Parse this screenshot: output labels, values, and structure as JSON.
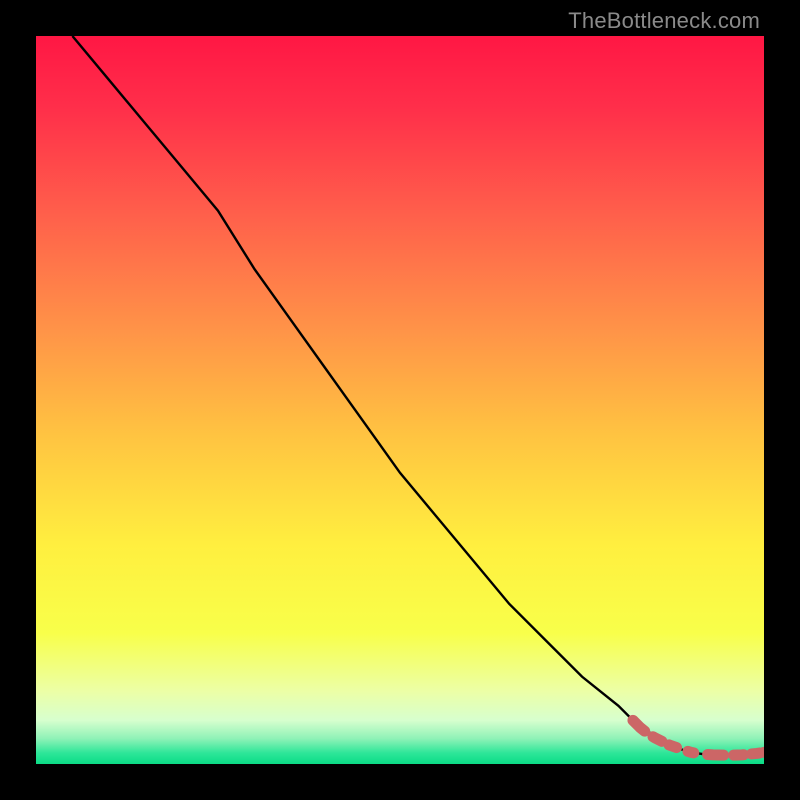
{
  "watermark": "TheBottleneck.com",
  "colors": {
    "frame": "#000000",
    "line": "#000000",
    "marker_fill": "#cc6666",
    "marker_stroke": "#b24f4f",
    "gradient_stops": [
      {
        "offset": 0.0,
        "color": "#ff1744"
      },
      {
        "offset": 0.1,
        "color": "#ff2f4a"
      },
      {
        "offset": 0.25,
        "color": "#ff614b"
      },
      {
        "offset": 0.4,
        "color": "#ff9248"
      },
      {
        "offset": 0.55,
        "color": "#ffc441"
      },
      {
        "offset": 0.7,
        "color": "#ffef3f"
      },
      {
        "offset": 0.82,
        "color": "#f8ff4a"
      },
      {
        "offset": 0.9,
        "color": "#ecffa6"
      },
      {
        "offset": 0.94,
        "color": "#d7ffce"
      },
      {
        "offset": 0.965,
        "color": "#8ff2b7"
      },
      {
        "offset": 0.985,
        "color": "#2de699"
      },
      {
        "offset": 1.0,
        "color": "#0bdc86"
      }
    ]
  },
  "chart_data": {
    "type": "line",
    "title": "",
    "xlabel": "",
    "ylabel": "",
    "xlim": [
      0,
      100
    ],
    "ylim": [
      0,
      100
    ],
    "categories_note": "Axes are unlabeled in the source image; x and y are normalized 0..100 from left→right and bottom→top.",
    "series": [
      {
        "name": "bottleneck-curve",
        "x": [
          5,
          10,
          15,
          20,
          25,
          30,
          35,
          40,
          45,
          50,
          55,
          60,
          65,
          70,
          75,
          80,
          82,
          84,
          86,
          88,
          90,
          92,
          94,
          96,
          98,
          100
        ],
        "y": [
          100,
          94,
          88,
          82,
          76,
          68,
          61,
          54,
          47,
          40,
          34,
          28,
          22,
          17,
          12,
          8,
          6,
          4.5,
          3.2,
          2.2,
          1.6,
          1.3,
          1.2,
          1.2,
          1.4,
          1.6
        ]
      }
    ],
    "markers": {
      "name": "highlight-segment",
      "x": [
        82,
        83,
        84,
        85,
        87,
        89,
        90,
        91,
        93,
        95,
        97,
        99,
        100
      ],
      "y": [
        6.0,
        5.0,
        4.2,
        3.6,
        2.6,
        1.9,
        1.6,
        1.4,
        1.25,
        1.2,
        1.25,
        1.45,
        1.6
      ]
    }
  }
}
